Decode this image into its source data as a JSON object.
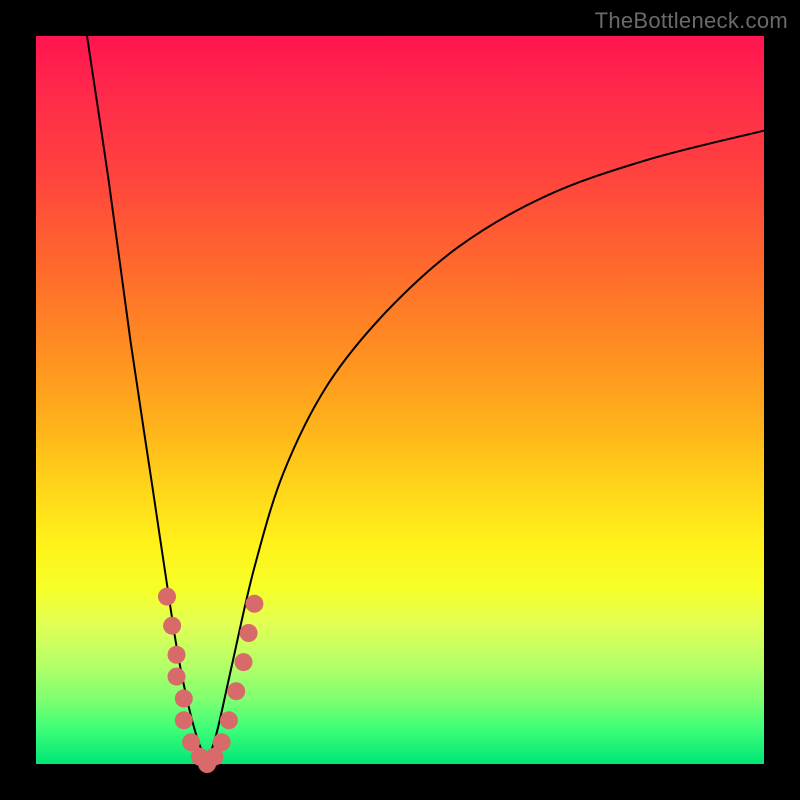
{
  "watermark_text": "TheBottleneck.com",
  "colors": {
    "frame": "#000000",
    "marker": "#d86a6a",
    "curve": "#000000",
    "gradient_top": "#ff1450",
    "gradient_bottom": "#00e676"
  },
  "chart_data": {
    "type": "line",
    "title": "",
    "xlabel": "",
    "ylabel": "",
    "xlim": [
      0,
      100
    ],
    "ylim": [
      0,
      100
    ],
    "grid": false,
    "legend": false,
    "note": "x and y are percentages of plot width/height; y=0 at bottom, y=100 at top.",
    "series": [
      {
        "name": "left-branch",
        "x": [
          7,
          10,
          13,
          16,
          19,
          20.5,
          22,
          23.5
        ],
        "y": [
          100,
          80,
          58,
          38,
          18,
          10,
          4,
          0
        ]
      },
      {
        "name": "right-branch",
        "x": [
          23.5,
          25,
          27,
          30,
          34,
          40,
          48,
          58,
          70,
          84,
          100
        ],
        "y": [
          0,
          5,
          14,
          27,
          40,
          52,
          62,
          71,
          78,
          83,
          87
        ]
      }
    ],
    "markers": {
      "name": "highlight-points",
      "note": "salmon dots clustered near the V-notch bottom",
      "points": [
        {
          "x": 18.0,
          "y": 23
        },
        {
          "x": 18.7,
          "y": 19
        },
        {
          "x": 19.3,
          "y": 15
        },
        {
          "x": 19.3,
          "y": 12
        },
        {
          "x": 20.3,
          "y": 9
        },
        {
          "x": 20.3,
          "y": 6
        },
        {
          "x": 21.3,
          "y": 3
        },
        {
          "x": 22.5,
          "y": 1
        },
        {
          "x": 23.5,
          "y": 0
        },
        {
          "x": 24.5,
          "y": 1
        },
        {
          "x": 25.5,
          "y": 3
        },
        {
          "x": 26.5,
          "y": 6
        },
        {
          "x": 27.5,
          "y": 10
        },
        {
          "x": 28.5,
          "y": 14
        },
        {
          "x": 29.2,
          "y": 18
        },
        {
          "x": 30.0,
          "y": 22
        }
      ]
    }
  }
}
